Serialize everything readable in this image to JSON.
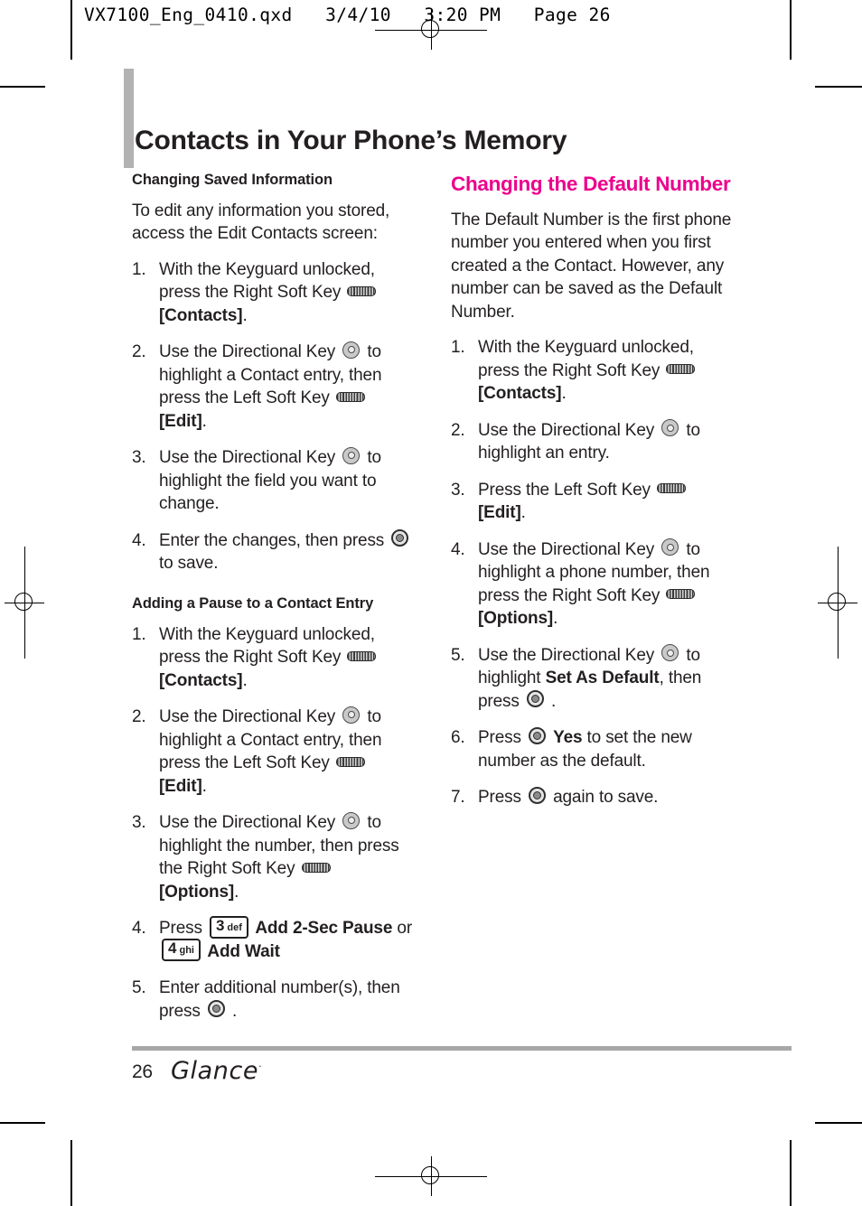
{
  "print_header": "VX7100_Eng_0410.qxd   3/4/10   3:20 PM   Page 26",
  "page_title": "Contacts in Your Phone’s Memory",
  "colors": {
    "accent_pink": "#ec008c",
    "title_bar_gray": "#b2b2b2",
    "footer_rule_gray": "#a7a7a7"
  },
  "left_column": {
    "section1": {
      "heading": "Changing Saved Information",
      "intro": "To edit any information you stored, access the Edit Contacts screen:",
      "steps": [
        {
          "num": "1.",
          "parts": [
            {
              "t": "text",
              "v": "With the Keyguard unlocked, press the Right Soft Key "
            },
            {
              "t": "icon",
              "v": "soft-key"
            },
            {
              "t": "text",
              "v": " "
            },
            {
              "t": "bold",
              "v": "[Contacts]"
            },
            {
              "t": "text",
              "v": "."
            }
          ]
        },
        {
          "num": "2.",
          "parts": [
            {
              "t": "text",
              "v": "Use the Directional Key "
            },
            {
              "t": "icon",
              "v": "directional-key"
            },
            {
              "t": "text",
              "v": " to highlight a Contact entry, then press the Left Soft Key "
            },
            {
              "t": "icon",
              "v": "soft-key"
            },
            {
              "t": "text",
              "v": " "
            },
            {
              "t": "bold",
              "v": "[Edit]"
            },
            {
              "t": "text",
              "v": "."
            }
          ]
        },
        {
          "num": "3.",
          "parts": [
            {
              "t": "text",
              "v": "Use the Directional Key "
            },
            {
              "t": "icon",
              "v": "directional-key"
            },
            {
              "t": "text",
              "v": " to highlight the field you want to change."
            }
          ]
        },
        {
          "num": "4.",
          "parts": [
            {
              "t": "text",
              "v": "Enter the changes, then press "
            },
            {
              "t": "icon",
              "v": "ok-key"
            },
            {
              "t": "text",
              "v": " to save."
            }
          ]
        }
      ]
    },
    "section2": {
      "heading": "Adding a Pause to a Contact Entry",
      "steps": [
        {
          "num": "1.",
          "parts": [
            {
              "t": "text",
              "v": "With the Keyguard unlocked, press the Right Soft Key "
            },
            {
              "t": "icon",
              "v": "soft-key"
            },
            {
              "t": "text",
              "v": " "
            },
            {
              "t": "bold",
              "v": "[Contacts]"
            },
            {
              "t": "text",
              "v": "."
            }
          ]
        },
        {
          "num": "2.",
          "parts": [
            {
              "t": "text",
              "v": "Use the Directional Key "
            },
            {
              "t": "icon",
              "v": "directional-key"
            },
            {
              "t": "text",
              "v": " to highlight a Contact entry, then press the Left Soft Key "
            },
            {
              "t": "icon",
              "v": "soft-key"
            },
            {
              "t": "text",
              "v": " "
            },
            {
              "t": "bold",
              "v": "[Edit]"
            },
            {
              "t": "text",
              "v": "."
            }
          ]
        },
        {
          "num": "3.",
          "parts": [
            {
              "t": "text",
              "v": "Use the Directional Key "
            },
            {
              "t": "icon",
              "v": "directional-key"
            },
            {
              "t": "text",
              "v": " to highlight the number, then press the Right Soft Key "
            },
            {
              "t": "icon",
              "v": "soft-key"
            },
            {
              "t": "text",
              "v": " "
            },
            {
              "t": "bold",
              "v": "[Options]"
            },
            {
              "t": "text",
              "v": "."
            }
          ]
        },
        {
          "num": "4.",
          "parts": [
            {
              "t": "text",
              "v": "Press "
            },
            {
              "t": "numkey",
              "d": "3",
              "l": "def"
            },
            {
              "t": "bold",
              "v": " Add 2-Sec Pause"
            },
            {
              "t": "text",
              "v": " or "
            },
            {
              "t": "numkey",
              "d": "4",
              "l": "ghi"
            },
            {
              "t": "bold",
              "v": " Add Wait"
            }
          ]
        },
        {
          "num": "5.",
          "parts": [
            {
              "t": "text",
              "v": "Enter additional number(s), then press "
            },
            {
              "t": "icon",
              "v": "ok-key"
            },
            {
              "t": "text",
              "v": " ."
            }
          ]
        }
      ]
    }
  },
  "right_column": {
    "heading": "Changing the Default Number",
    "intro": "The Default Number is the first phone number you entered when you first created a the Contact. However, any number can be saved as the Default Number.",
    "steps": [
      {
        "num": "1.",
        "parts": [
          {
            "t": "text",
            "v": "With the Keyguard unlocked, press the Right Soft Key "
          },
          {
            "t": "icon",
            "v": "soft-key"
          },
          {
            "t": "text",
            "v": " "
          },
          {
            "t": "bold",
            "v": "[Contacts]"
          },
          {
            "t": "text",
            "v": "."
          }
        ]
      },
      {
        "num": "2.",
        "parts": [
          {
            "t": "text",
            "v": "Use the Directional Key "
          },
          {
            "t": "icon",
            "v": "directional-key"
          },
          {
            "t": "text",
            "v": " to highlight an entry."
          }
        ]
      },
      {
        "num": "3.",
        "parts": [
          {
            "t": "text",
            "v": "Press the Left Soft Key "
          },
          {
            "t": "icon",
            "v": "soft-key"
          },
          {
            "t": "text",
            "v": " "
          },
          {
            "t": "bold",
            "v": "[Edit]"
          },
          {
            "t": "text",
            "v": "."
          }
        ]
      },
      {
        "num": "4.",
        "parts": [
          {
            "t": "text",
            "v": "Use the Directional Key "
          },
          {
            "t": "icon",
            "v": "directional-key"
          },
          {
            "t": "text",
            "v": " to highlight a phone number, then press the Right Soft Key "
          },
          {
            "t": "icon",
            "v": "soft-key"
          },
          {
            "t": "text",
            "v": " "
          },
          {
            "t": "bold",
            "v": "[Options]"
          },
          {
            "t": "text",
            "v": "."
          }
        ]
      },
      {
        "num": "5.",
        "parts": [
          {
            "t": "text",
            "v": "Use the Directional Key "
          },
          {
            "t": "icon",
            "v": "directional-key"
          },
          {
            "t": "text",
            "v": " to highlight "
          },
          {
            "t": "bold",
            "v": "Set As Default"
          },
          {
            "t": "text",
            "v": ", then press "
          },
          {
            "t": "icon",
            "v": "ok-key"
          },
          {
            "t": "text",
            "v": " ."
          }
        ]
      },
      {
        "num": "6.",
        "parts": [
          {
            "t": "text",
            "v": "Press "
          },
          {
            "t": "icon",
            "v": "ok-key"
          },
          {
            "t": "text",
            "v": " "
          },
          {
            "t": "bold",
            "v": "Yes"
          },
          {
            "t": "text",
            "v": " to set the new number as the default."
          }
        ]
      },
      {
        "num": "7.",
        "parts": [
          {
            "t": "text",
            "v": "Press "
          },
          {
            "t": "icon",
            "v": "ok-key"
          },
          {
            "t": "text",
            "v": " again to save."
          }
        ]
      }
    ]
  },
  "footer": {
    "page_number": "26",
    "logo": "Glance",
    "logo_tm": "·"
  }
}
